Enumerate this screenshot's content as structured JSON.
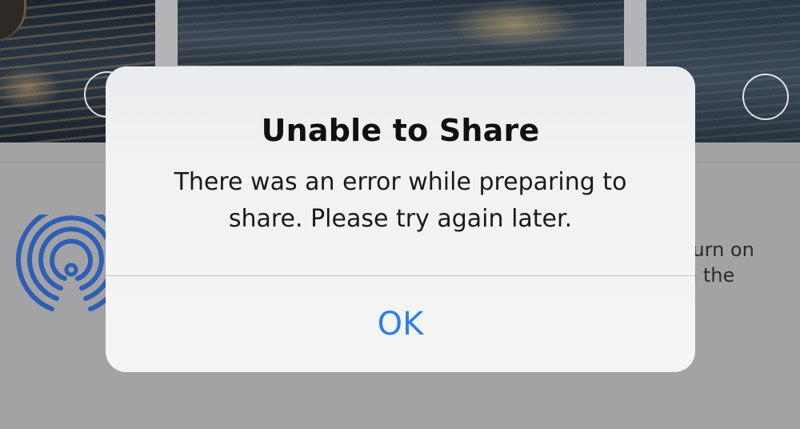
{
  "alert": {
    "title": "Unable to Share",
    "message_line1": "There was an error while preparing to",
    "message_line2": "share. Please try again later.",
    "ok_label": "OK",
    "accent_color": "#2f7fe6"
  },
  "airdrop": {
    "hint_line1": "turn on",
    "hint_line2": "n the",
    "icon": "airdrop-icon",
    "icon_color": "#2e5fb5"
  },
  "photos": {
    "count_visible": 3,
    "selection_icon": "selection-circle-icon"
  }
}
